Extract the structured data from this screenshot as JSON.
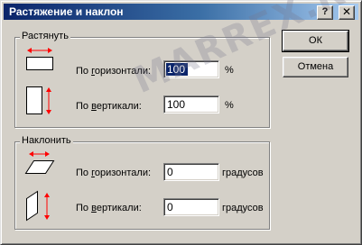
{
  "window": {
    "title": "Растяжение и наклон",
    "help_glyph": "?",
    "close_glyph": "✕"
  },
  "stretch": {
    "group_label": "Растянуть",
    "horizontal": {
      "label_pre": "По ",
      "label_u": "г",
      "label_post": "оризонтали:",
      "value": "100",
      "unit": "%"
    },
    "vertical": {
      "label_pre": "По ",
      "label_u": "в",
      "label_post": "ертикали:",
      "value": "100",
      "unit": "%"
    }
  },
  "skew": {
    "group_label": "Наклонить",
    "horizontal": {
      "label_pre": "По ",
      "label_u": "г",
      "label_post": "оризонтали:",
      "value": "0",
      "unit": "градусов"
    },
    "vertical": {
      "label_pre": "По ",
      "label_u": "в",
      "label_post": "ертикали:",
      "value": "0",
      "unit": "градусов"
    }
  },
  "buttons": {
    "ok": "ОК",
    "cancel": "Отмена"
  },
  "watermark": "MARREX.RU",
  "colors": {
    "titlebar_start": "#0a246a",
    "titlebar_end": "#a6caf0",
    "arrow_red": "#ff0000",
    "face": "#d4d0c8"
  },
  "icons": [
    "stretch-horizontal-icon",
    "stretch-vertical-icon",
    "skew-horizontal-icon",
    "skew-vertical-icon"
  ]
}
